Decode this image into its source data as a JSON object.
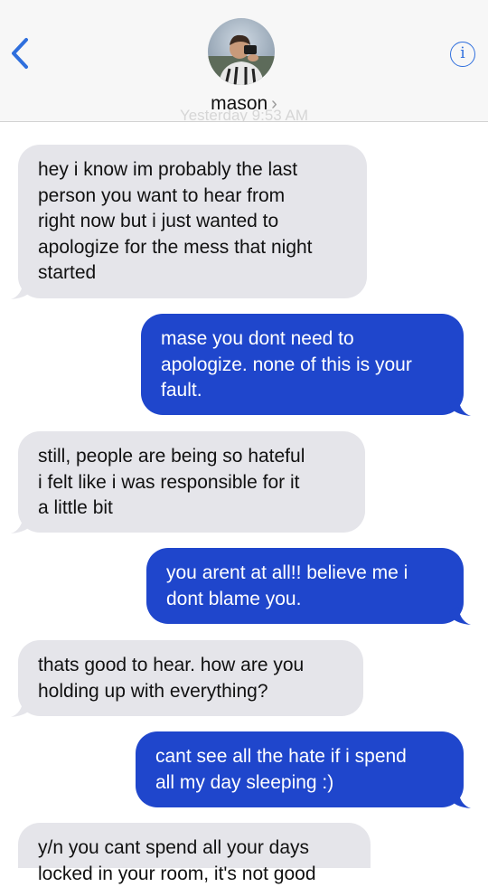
{
  "header": {
    "contact_name": "mason",
    "chevron": "›",
    "info_label": "i",
    "ghost_timestamp": "Yesterday 9:53 AM",
    "icons": {
      "back": "chevron-left-icon",
      "info": "info-icon"
    }
  },
  "colors": {
    "sent_bubble": "#1f46cc",
    "received_bubble": "#e5e5ea",
    "accent": "#2f6fdd"
  },
  "messages": [
    {
      "from": "mason",
      "text": "hey i know im probably the last\nperson you want to hear from\nright now but i just wanted to\napologize for the mess that night\nstarted"
    },
    {
      "from": "me",
      "text": "mase you dont need to\napologize. none of this is your\nfault."
    },
    {
      "from": "mason",
      "text": "still, people are being so hateful\ni felt like i was responsible for it\na little bit"
    },
    {
      "from": "me",
      "text": "you arent at all!! believe me i\ndont blame you."
    },
    {
      "from": "mason",
      "text": "thats good to hear. how are you\nholding up with everything?"
    },
    {
      "from": "me",
      "text": "cant see all the hate if i spend\nall my day sleeping :)"
    },
    {
      "from": "mason",
      "text": "y/n you cant spend all your days\nlocked in your room, it's not good"
    }
  ]
}
